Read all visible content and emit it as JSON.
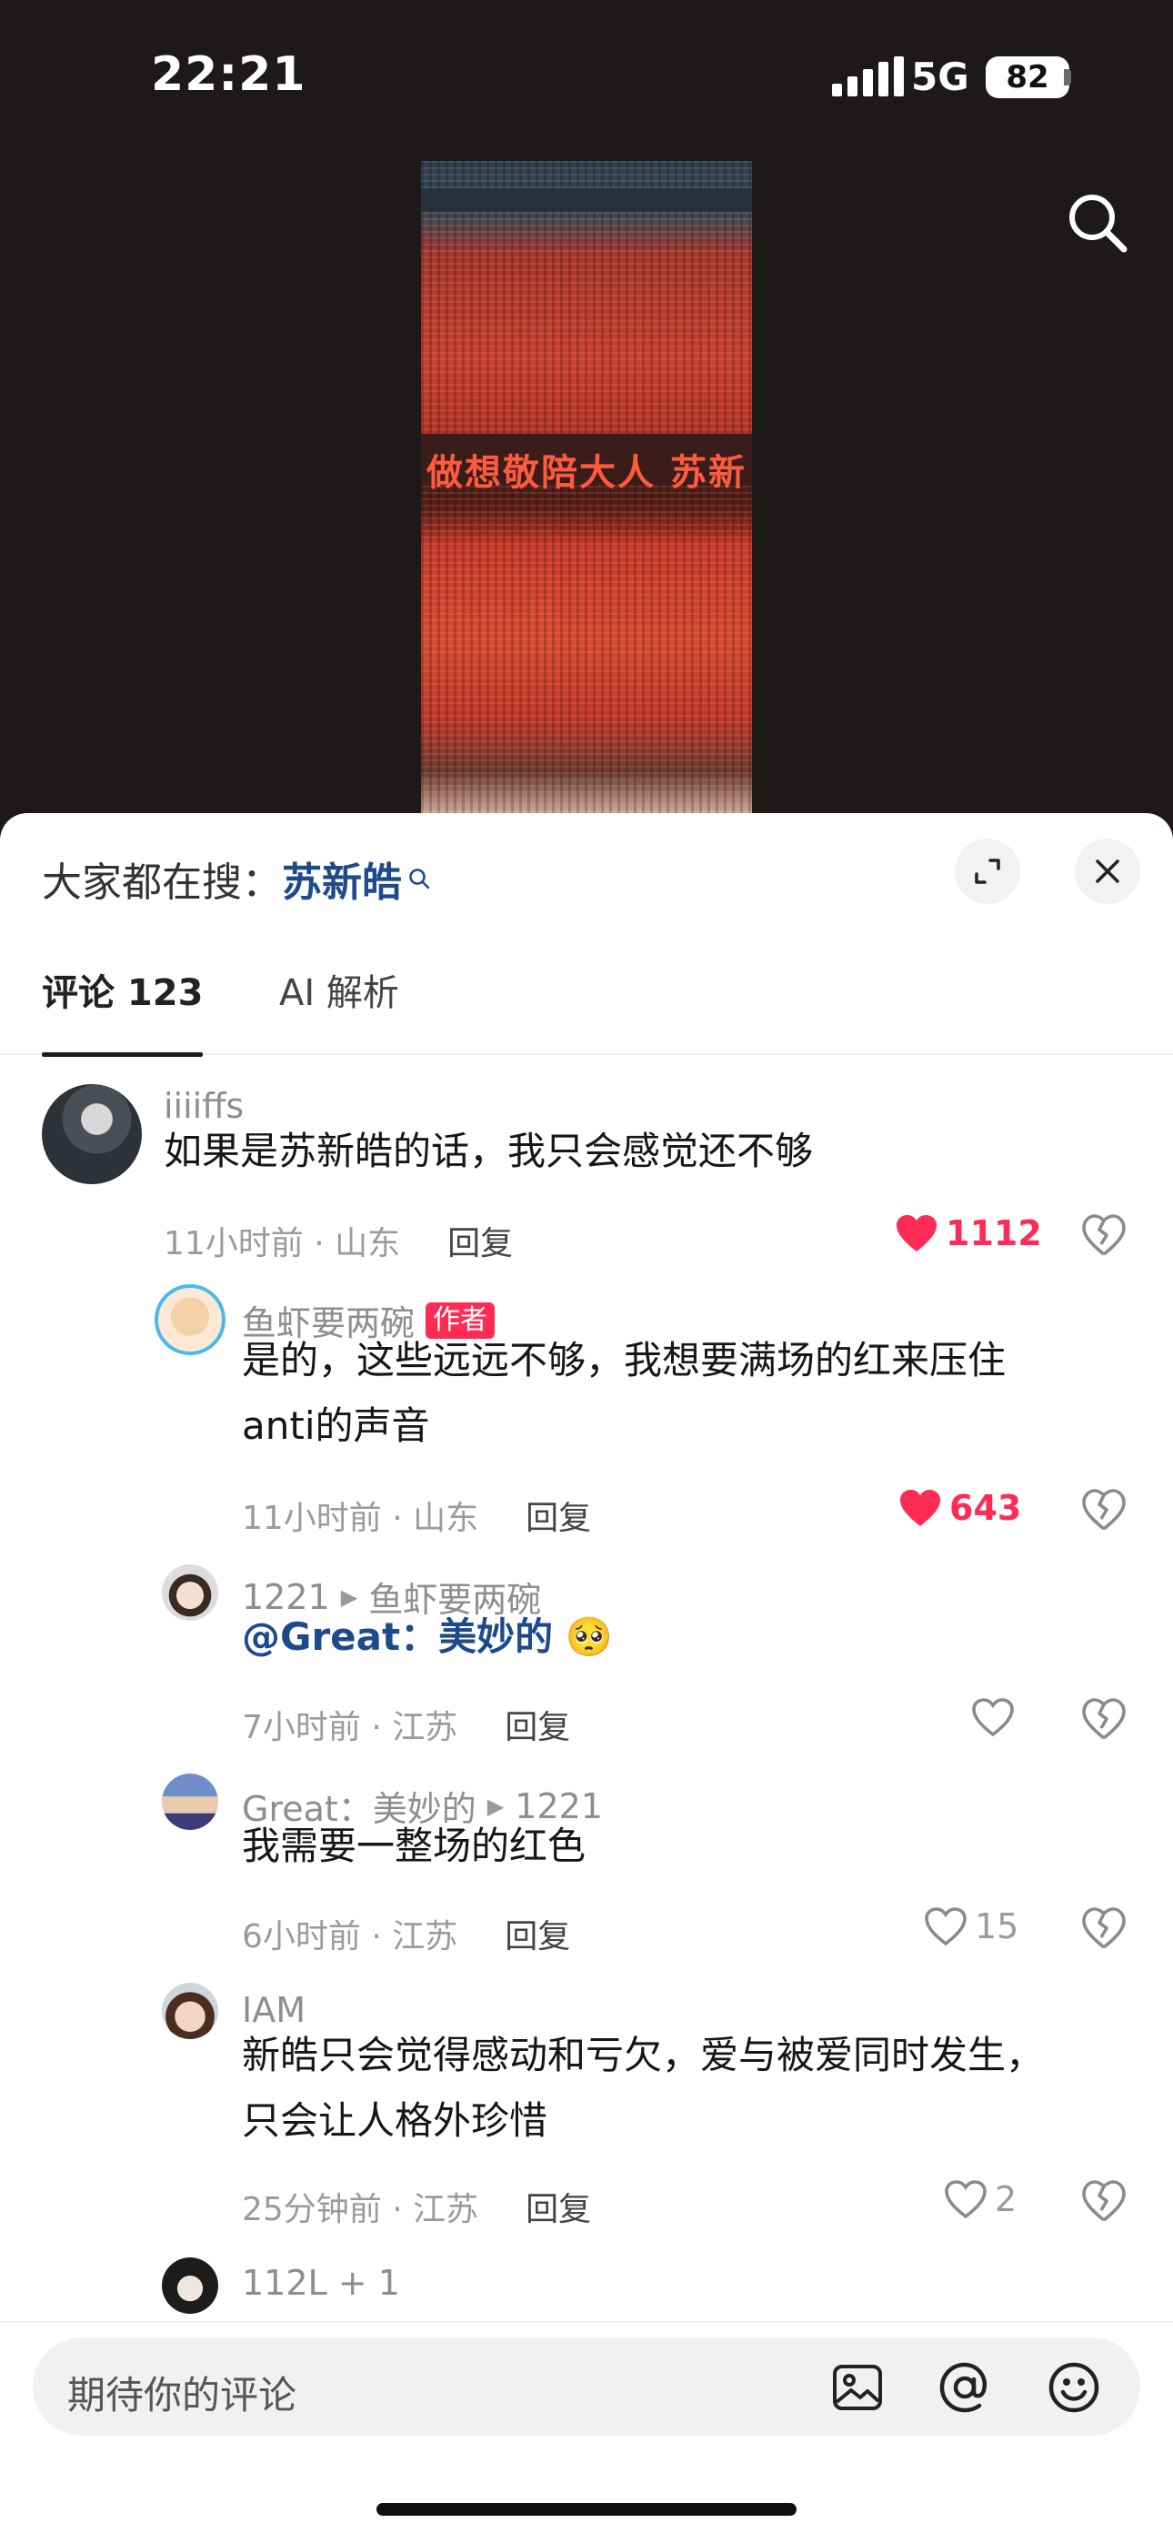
{
  "status": {
    "time": "22:21",
    "network": "5G",
    "battery": "82"
  },
  "video": {
    "banner_text": "做想敬陪大人 苏新"
  },
  "sheet": {
    "trend_prefix": "大家都在搜：",
    "trend_keyword": "苏新皓",
    "tabs": [
      {
        "label": "评论 123"
      },
      {
        "label": "AI 解析"
      }
    ]
  },
  "comments": [
    {
      "user": "iiiiffs",
      "text": "如果是苏新皓的话，我只会感觉还不够",
      "time": "11小时前 · 山东",
      "reply": "回复",
      "likes": "1112",
      "liked": true
    },
    {
      "user": "鱼虾要两碗",
      "badge": "作者",
      "text_line1": "是的，这些远远不够，我想要满场的红来压住",
      "text_line2": "anti的声音",
      "time": "11小时前 · 山东",
      "reply": "回复",
      "likes": "643",
      "liked": true
    },
    {
      "user": "1221",
      "reply_to": "鱼虾要两碗",
      "mention": "@Great：美妙的",
      "emoji": "🥺",
      "time": "7小时前 · 江苏",
      "reply": "回复",
      "likes": "",
      "liked": false
    },
    {
      "user": "Great：美妙的",
      "reply_to": "1221",
      "text": "我需要一整场的红色",
      "time": "6小时前 · 江苏",
      "reply": "回复",
      "likes": "15",
      "liked": false
    },
    {
      "user": "IAM",
      "text_line1": "新皓只会觉得感动和亏欠，爱与被爱同时发生，",
      "text_line2": "只会让人格外珍惜",
      "time": "25分钟前 · 江苏",
      "reply": "回复",
      "likes": "2",
      "liked": false
    },
    {
      "user": "112L + 1"
    }
  ],
  "input": {
    "placeholder": "期待你的评论"
  },
  "icons": [
    "search-icon",
    "expand-icon",
    "close-icon",
    "heart-icon",
    "dislike-icon",
    "image-icon",
    "at-icon",
    "emoji-icon"
  ]
}
